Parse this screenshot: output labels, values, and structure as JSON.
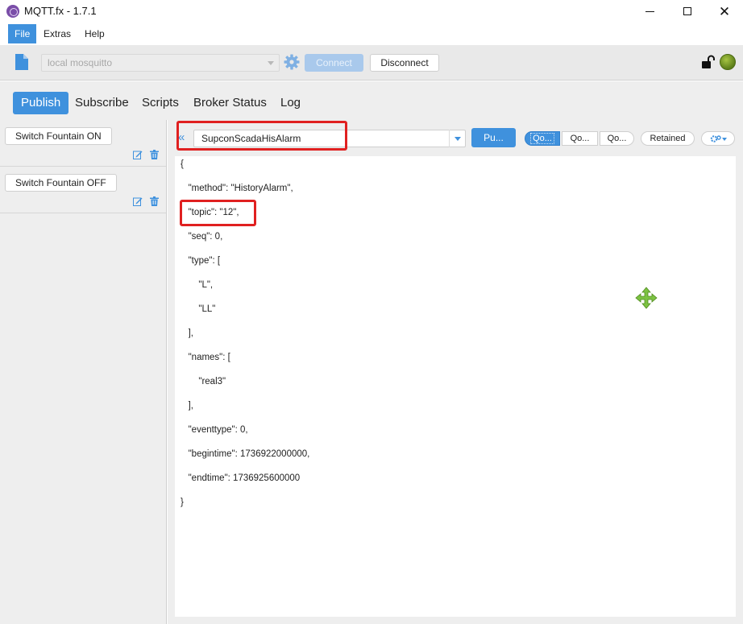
{
  "window": {
    "title": "MQTT.fx - 1.7.1",
    "close_glyph": "✕"
  },
  "menu": {
    "items": [
      "File",
      "Extras",
      "Help"
    ]
  },
  "connection": {
    "profile_value": "local mosquitto",
    "connect_label": "Connect",
    "disconnect_label": "Disconnect",
    "status_color": "#7ea22e"
  },
  "tabs": [
    "Publish",
    "Subscribe",
    "Scripts",
    "Broker Status",
    "Log"
  ],
  "saved_publishes": [
    {
      "label": "Switch Fountain ON"
    },
    {
      "label": "Switch Fountain OFF"
    }
  ],
  "publish": {
    "collapse_glyph": "«",
    "topic": "SupconScadaHisAlarm",
    "publish_label": "Pu...",
    "qos": [
      "Qo...",
      "Qo...",
      "Qo..."
    ],
    "qos_selected": 0,
    "retained_label": "Retained"
  },
  "payload": {
    "lines": [
      "{",
      "   \"method\": \"HistoryAlarm\",",
      "   \"topic\": \"12\",",
      "   \"seq\": 0,",
      "   \"type\": [",
      "       \"L\",",
      "       \"LL\"",
      "   ],",
      "   \"names\": [",
      "       \"real3\"",
      "   ],",
      "   \"eventtype\": 0,",
      "   \"begintime\": 1736922000000,",
      "   \"endtime\": 1736925600000",
      "}"
    ]
  },
  "colors": {
    "accent": "#3f91dd",
    "highlight": "#e02020",
    "move_icon": "#7cc242"
  }
}
